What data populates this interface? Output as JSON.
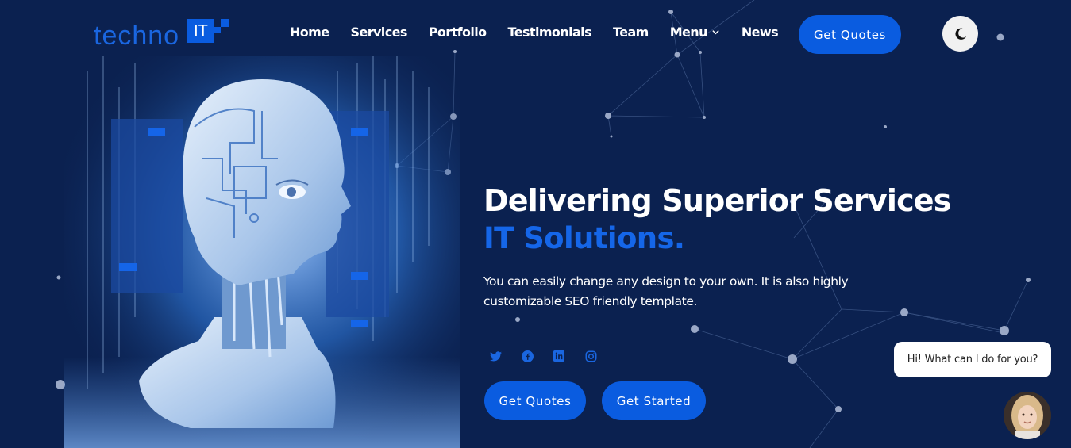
{
  "header": {
    "logo_text": "techno",
    "logo_badge": "IT",
    "nav": [
      {
        "label": "Home"
      },
      {
        "label": "Services"
      },
      {
        "label": "Portfolio"
      },
      {
        "label": "Testimonials"
      },
      {
        "label": "Team"
      },
      {
        "label": "Menu",
        "icon": "chevron-down-icon"
      },
      {
        "label": "News"
      }
    ],
    "quote_button": "Get Quotes",
    "theme_toggle_icon": "moon-icon"
  },
  "hero": {
    "title": "Delivering Superior Services",
    "subtitle": "IT Solutions.",
    "description": "You can easily change any design to your own. It is also highly customizable SEO friendly template.",
    "socials": [
      "twitter-icon",
      "facebook-icon",
      "linkedin-icon",
      "instagram-icon"
    ],
    "primary_button": "Get Quotes",
    "secondary_button": "Get Started",
    "image": "ai-robot-head-illustration"
  },
  "chat": {
    "message": "Hi! What can I do for you?",
    "avatar": "support-agent-avatar"
  },
  "colors": {
    "background": "#0b2150",
    "accent": "#0a5ce0",
    "subtitle": "#1566e8"
  }
}
